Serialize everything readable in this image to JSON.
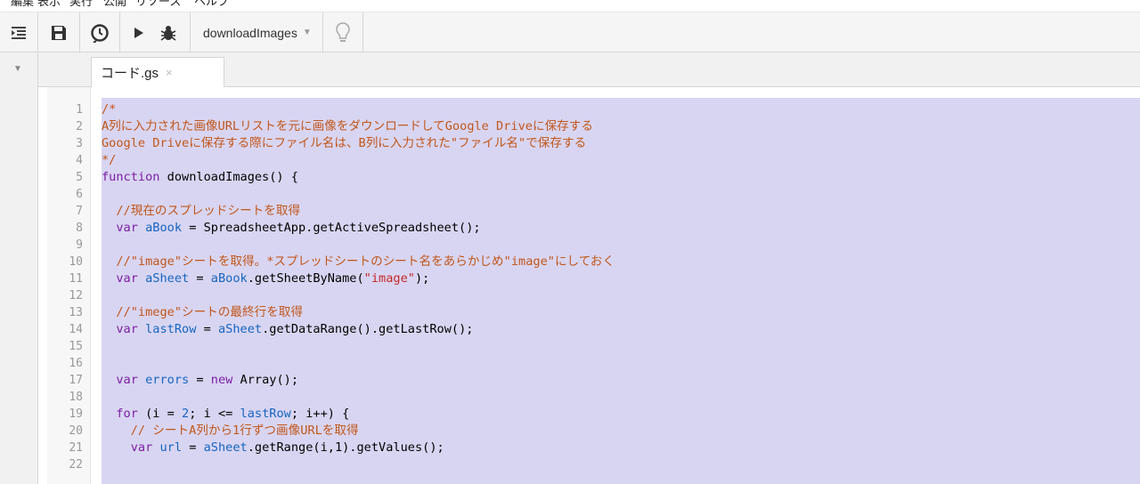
{
  "menu": [
    "編集",
    "表示",
    "実行",
    "公開",
    "リソース",
    "ヘルプ"
  ],
  "toolbar": {
    "function_name": "downloadImages",
    "icons": [
      "indent-icon",
      "save-icon",
      "triggers-icon",
      "run-icon",
      "debug-icon",
      "lightbulb-icon"
    ]
  },
  "tab": {
    "name": "コード.gs",
    "close": "×"
  },
  "lines": [
    {
      "n": "1",
      "t": [
        [
          "c",
          "/*"
        ]
      ]
    },
    {
      "n": "2",
      "t": [
        [
          "c",
          "A列に入力された画像URLリストを元に画像をダウンロードしてGoogle Driveに保存する"
        ]
      ]
    },
    {
      "n": "3",
      "t": [
        [
          "c",
          "Google Driveに保存する際にファイル名は、B列に入力された\"ファイル名\"で保存する"
        ]
      ]
    },
    {
      "n": "4",
      "t": [
        [
          "c",
          "*/"
        ]
      ]
    },
    {
      "n": "5",
      "t": [
        [
          "k",
          "function"
        ],
        [
          "p",
          " downloadImages() {"
        ]
      ]
    },
    {
      "n": "6",
      "t": []
    },
    {
      "n": "7",
      "t": [
        [
          "p",
          "  "
        ],
        [
          "c",
          "//現在のスプレッドシートを取得"
        ]
      ]
    },
    {
      "n": "8",
      "t": [
        [
          "p",
          "  "
        ],
        [
          "k",
          "var"
        ],
        [
          "p",
          " "
        ],
        [
          "v",
          "aBook"
        ],
        [
          "p",
          " = SpreadsheetApp.getActiveSpreadsheet();"
        ]
      ]
    },
    {
      "n": "9",
      "t": []
    },
    {
      "n": "10",
      "t": [
        [
          "p",
          "  "
        ],
        [
          "c",
          "//\"image\"シートを取得。*スプレッドシートのシート名をあらかじめ\"image\"にしておく"
        ]
      ]
    },
    {
      "n": "11",
      "t": [
        [
          "p",
          "  "
        ],
        [
          "k",
          "var"
        ],
        [
          "p",
          " "
        ],
        [
          "v",
          "aSheet"
        ],
        [
          "p",
          " = "
        ],
        [
          "v",
          "aBook"
        ],
        [
          "p",
          ".getSheetByName("
        ],
        [
          "s",
          "\"image\""
        ],
        [
          "p",
          ");"
        ]
      ]
    },
    {
      "n": "12",
      "t": []
    },
    {
      "n": "13",
      "t": [
        [
          "p",
          "  "
        ],
        [
          "c",
          "//\"imege\"シートの最終行を取得"
        ]
      ]
    },
    {
      "n": "14",
      "t": [
        [
          "p",
          "  "
        ],
        [
          "k",
          "var"
        ],
        [
          "p",
          " "
        ],
        [
          "v",
          "lastRow"
        ],
        [
          "p",
          " = "
        ],
        [
          "v",
          "aSheet"
        ],
        [
          "p",
          ".getDataRange().getLastRow();"
        ]
      ]
    },
    {
      "n": "15",
      "t": []
    },
    {
      "n": "16",
      "t": []
    },
    {
      "n": "17",
      "t": [
        [
          "p",
          "  "
        ],
        [
          "k",
          "var"
        ],
        [
          "p",
          " "
        ],
        [
          "v",
          "errors"
        ],
        [
          "p",
          " = "
        ],
        [
          "k",
          "new"
        ],
        [
          "p",
          " Array();"
        ]
      ]
    },
    {
      "n": "18",
      "t": []
    },
    {
      "n": "19",
      "t": [
        [
          "p",
          "  "
        ],
        [
          "k",
          "for"
        ],
        [
          "p",
          " (i = "
        ],
        [
          "n",
          "2"
        ],
        [
          "p",
          "; i <= "
        ],
        [
          "v",
          "lastRow"
        ],
        [
          "p",
          "; i++) {"
        ]
      ]
    },
    {
      "n": "20",
      "t": [
        [
          "p",
          "    "
        ],
        [
          "c",
          "// シートA列から1行ずつ画像URLを取得"
        ]
      ]
    },
    {
      "n": "21",
      "t": [
        [
          "p",
          "    "
        ],
        [
          "k",
          "var"
        ],
        [
          "p",
          " "
        ],
        [
          "v",
          "url"
        ],
        [
          "p",
          " = "
        ],
        [
          "v",
          "aSheet"
        ],
        [
          "p",
          ".getRange(i,1).getValues();"
        ]
      ]
    },
    {
      "n": "22",
      "t": []
    }
  ]
}
